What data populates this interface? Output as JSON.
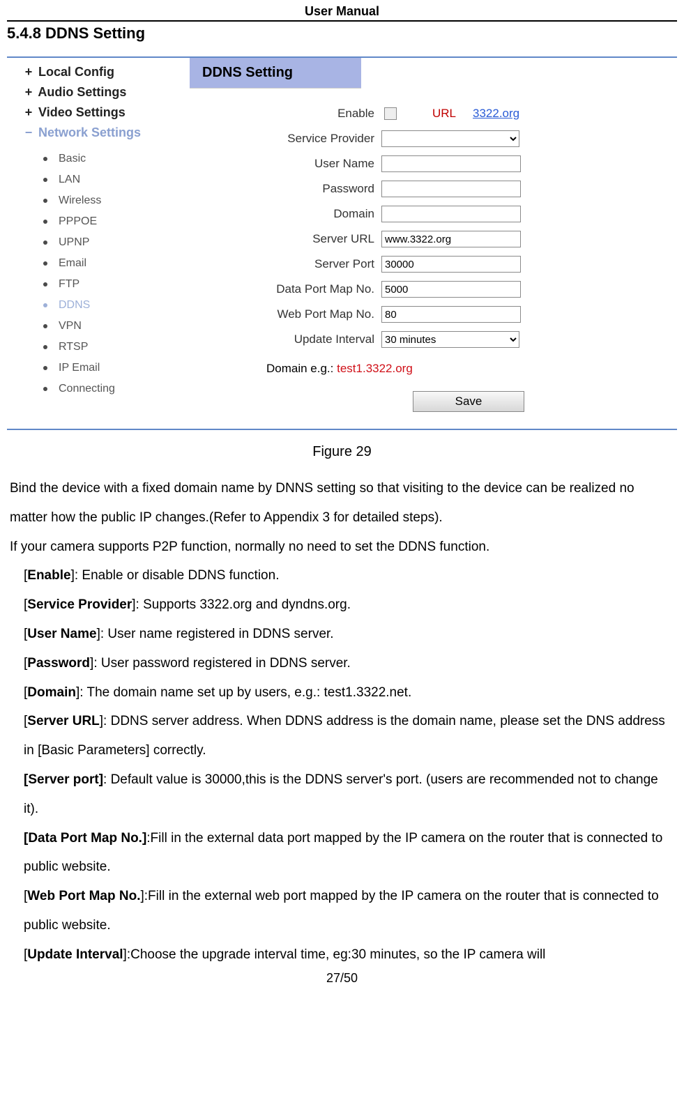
{
  "header": "User Manual",
  "section_number": "5.4.8 DDNS Setting",
  "sidebar": {
    "groups": [
      {
        "icon": "+",
        "label": "Local Config",
        "active": false
      },
      {
        "icon": "+",
        "label": "Audio Settings",
        "active": false
      },
      {
        "icon": "+",
        "label": "Video Settings",
        "active": false
      },
      {
        "icon": "−",
        "label": "Network Settings",
        "active": true
      }
    ],
    "items": [
      {
        "label": "Basic",
        "active": false
      },
      {
        "label": "LAN",
        "active": false
      },
      {
        "label": "Wireless",
        "active": false
      },
      {
        "label": "PPPOE",
        "active": false
      },
      {
        "label": "UPNP",
        "active": false
      },
      {
        "label": "Email",
        "active": false
      },
      {
        "label": "FTP",
        "active": false
      },
      {
        "label": "DDNS",
        "active": true
      },
      {
        "label": "VPN",
        "active": false
      },
      {
        "label": "RTSP",
        "active": false
      },
      {
        "label": "IP Email",
        "active": false
      },
      {
        "label": "Connecting",
        "active": false
      }
    ]
  },
  "panel_title": "DDNS Setting",
  "form": {
    "enable_label": "Enable",
    "url_label": "URL",
    "url_link": "3322.org",
    "service_provider_label": "Service Provider",
    "service_provider_value": "",
    "user_name_label": "User Name",
    "user_name_value": "",
    "password_label": "Password",
    "password_value": "",
    "domain_label": "Domain",
    "domain_value": "",
    "server_url_label": "Server URL",
    "server_url_value": "www.3322.org",
    "server_port_label": "Server Port",
    "server_port_value": "30000",
    "data_port_label": "Data Port Map No.",
    "data_port_value": "5000",
    "web_port_label": "Web Port Map No.",
    "web_port_value": "80",
    "update_interval_label": "Update Interval",
    "update_interval_value": "30 minutes",
    "example_prefix": "Domain e.g.: ",
    "example_value": "test1.3322.org",
    "save_label": "Save"
  },
  "figure_caption": "Figure 29",
  "body": {
    "p1": "Bind the device with a fixed domain name by DNNS setting so that visiting to the device can be realized no matter how the public IP changes.(Refer to Appendix 3 for detailed steps).",
    "p2": "If your camera supports P2P function, normally no need to set the DDNS function.",
    "enable_k": "Enable",
    "enable_v": "]: Enable or disable DDNS function.",
    "sp_k": "Service Provider",
    "sp_v": "]: Supports 3322.org and dyndns.org.",
    "un_k": "User Name",
    "un_v": "]: User name registered in DDNS server.",
    "pw_k": "Password",
    "pw_v": "]: User password registered in DDNS server.",
    "dom_k": "Domain",
    "dom_v": "]: The domain name set up by users, e.g.: test1.3322.net.",
    "surl_k": "Server URL",
    "surl_v": "]: DDNS server address. When DDNS address is the domain name, please set the DNS address in [Basic Parameters] correctly.",
    "sport_k": "[Server port]",
    "sport_v": ": Default value is 30000,this is the DDNS server's port. (users are recommended not to change it).",
    "dpm_k": "[Data Port Map No.]",
    "dpm_v": ":Fill in the external data port mapped by the IP camera on the router that is connected to public website.",
    "wpm_k": "Web Port Map No.",
    "wpm_v": "]:Fill in the external web port mapped by the IP camera on the router that is connected to public website.",
    "ui_k": "Update Interval",
    "ui_v": "]:Choose the upgrade interval time, eg:30 minutes, so the IP camera will"
  },
  "footer": "27/50"
}
